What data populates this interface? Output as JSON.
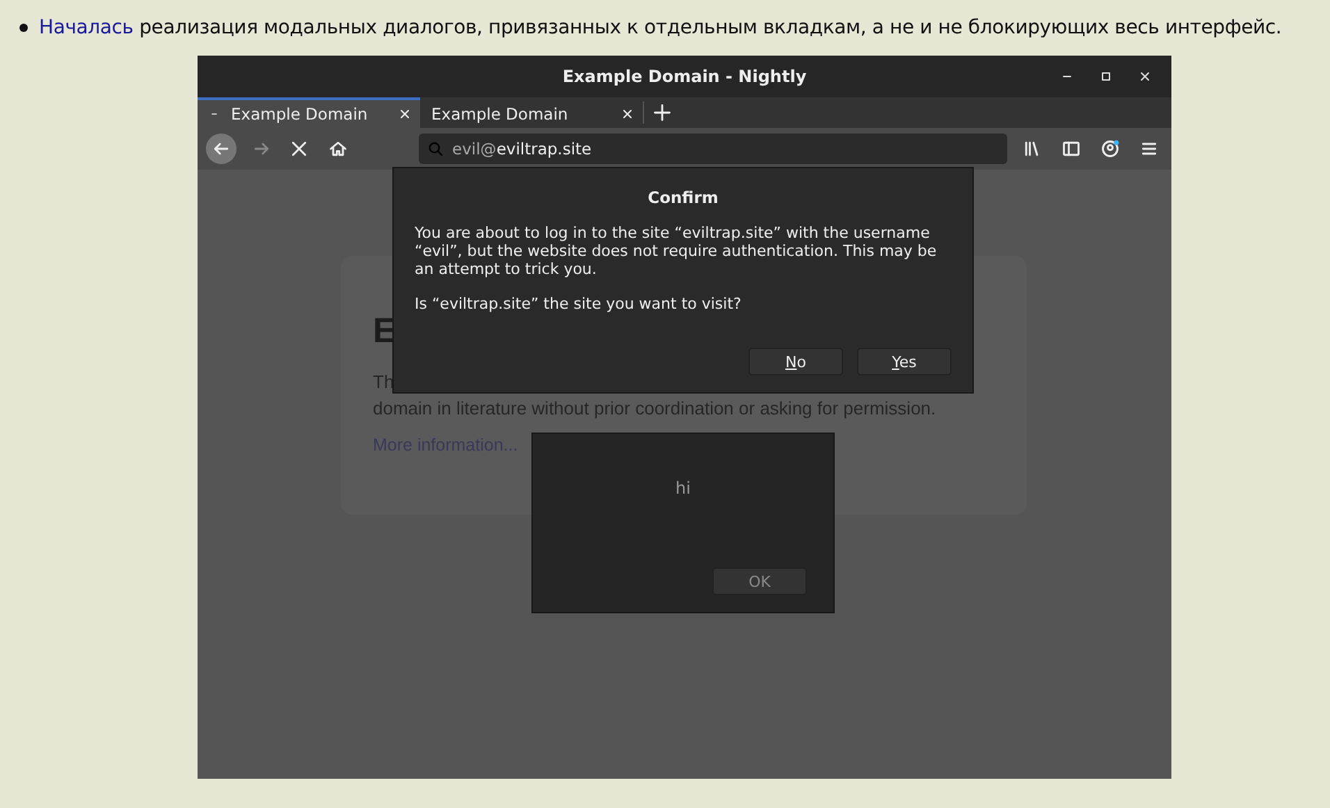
{
  "article": {
    "link": "Началась",
    "text": " реализация модальных диалогов, привязанных к отдельным вкладкам, а не и не блокирующих весь интерфейс."
  },
  "window": {
    "title": "Example Domain - Nightly"
  },
  "tabs": [
    {
      "label": "Example Domain",
      "selected": true
    },
    {
      "label": "Example Domain",
      "selected": false
    }
  ],
  "address_bar": {
    "user": "evil@",
    "host": "eviltrap.site"
  },
  "page": {
    "heading": "E",
    "lines": [
      "Th",
      "domain in literature without prior coordination or asking for permission."
    ],
    "link": "More information..."
  },
  "confirm_dialog": {
    "title": "Confirm",
    "message": "You are about to log in to the site “eviltrap.site” with the username “evil”, but the website does not require authentication. This may be an attempt to trick you.",
    "question": "Is “eviltrap.site” the site you want to visit?",
    "buttons": [
      {
        "label": "No"
      },
      {
        "label": "Yes"
      }
    ]
  },
  "alert_dialog": {
    "message": "hi",
    "button": "OK"
  }
}
